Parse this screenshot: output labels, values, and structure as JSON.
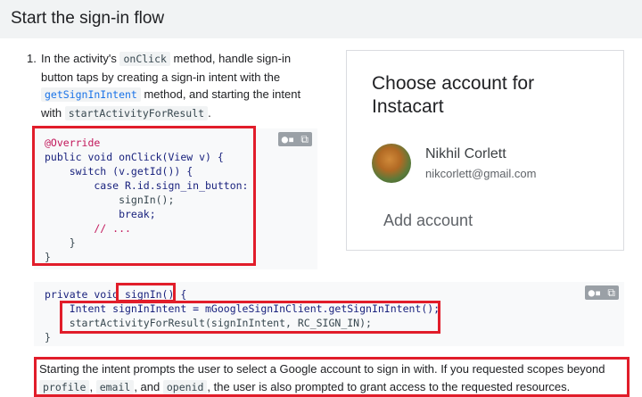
{
  "heading": "Start the sign-in flow",
  "step": {
    "number": "1.",
    "t1": "In the activity's ",
    "c1": "onClick",
    "t2": " method, handle sign-in button taps by creating a sign-in intent with the ",
    "c2": "getSignInIntent",
    "t3": " method, and starting the intent with ",
    "c3": "startActivityForResult",
    "t4": "."
  },
  "code1": {
    "lines": [
      "@Override",
      "public void onClick(View v) {",
      "    switch (v.getId()) {",
      "        case R.id.sign_in_button:",
      "            signIn();",
      "            break;",
      "        // ...",
      "    }",
      "}"
    ]
  },
  "code2": {
    "lines": [
      "private void signIn() {",
      "    Intent signInIntent = mGoogleSignInClient.getSignInIntent();",
      "    startActivityForResult(signInIntent, RC_SIGN_IN);",
      "}"
    ]
  },
  "toolbar_icons": [
    "toggle-dark-icon",
    "copy-icon"
  ],
  "card": {
    "title": "Choose account for Instacart",
    "account_name": "Nikhil Corlett",
    "account_email": "nikcorlett@gmail.com",
    "add_account": "Add account"
  },
  "note": {
    "t1": "Starting the intent prompts the user to select a Google account to sign in with. If you requested scopes beyond ",
    "c1": "profile",
    "t2": ", ",
    "c2": "email",
    "t3": ", and ",
    "c3": "openid",
    "t4": ", the user is also prompted to grant access to the requested resources."
  },
  "colors": {
    "highlight": "#e11d2a",
    "link": "#1a73e8",
    "code_bg": "#f8f9fa"
  }
}
